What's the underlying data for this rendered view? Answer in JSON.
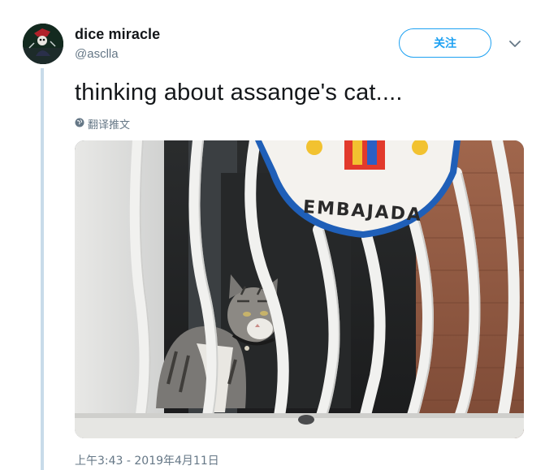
{
  "tweet": {
    "display_name": "dice miracle",
    "handle": "@asclla",
    "follow_label": "关注",
    "text": "thinking about assange's cat....",
    "translate_label": "翻译推文",
    "timestamp": "上午3:43 - 2019年4月11日",
    "media": {
      "sign_text": "EMBAJADA"
    }
  },
  "icons": {
    "caret": "chevron-down-icon",
    "translate": "globe-icon"
  },
  "colors": {
    "accent": "#1da1f2",
    "thread_line": "#c8dbe9",
    "muted_text": "#657786"
  }
}
